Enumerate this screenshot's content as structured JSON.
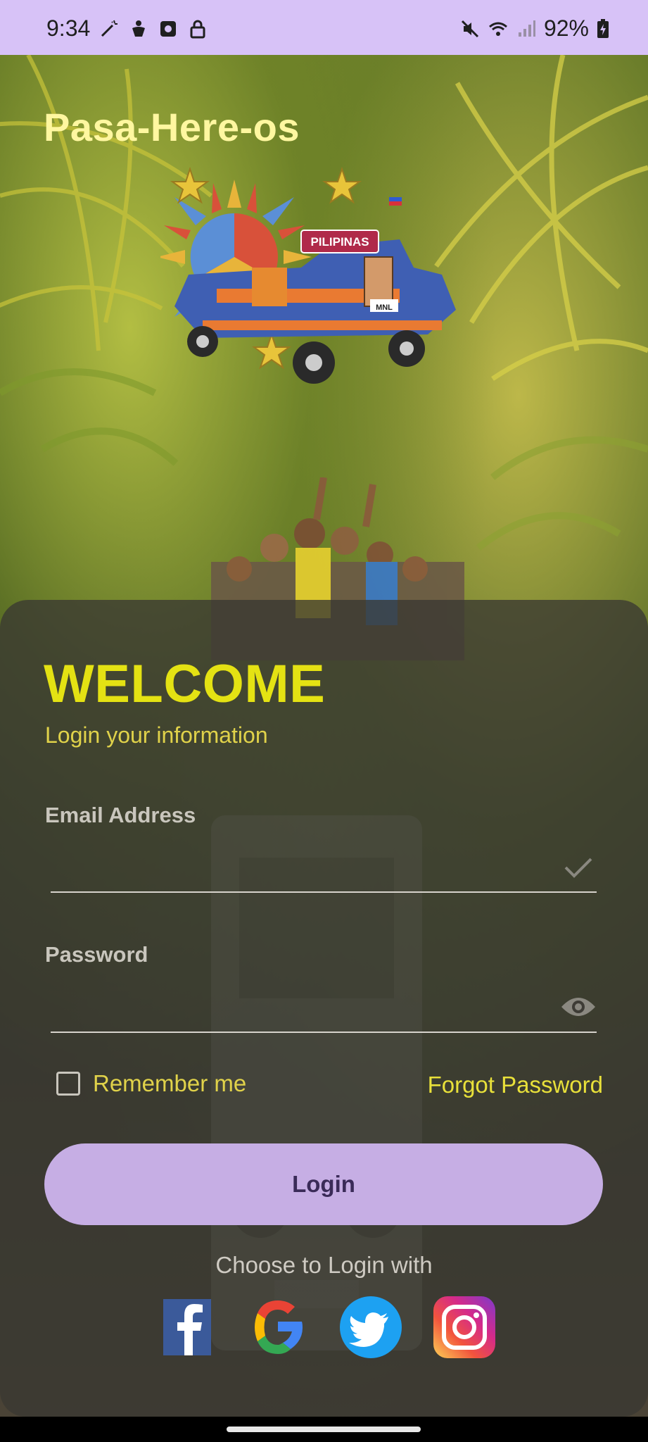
{
  "status_bar": {
    "time": "9:34",
    "battery": "92%",
    "left_icons": [
      "magic-wand-icon",
      "accessibility-icon",
      "screen-record-icon",
      "lock-icon"
    ],
    "right_icons": [
      "mute-icon",
      "wifi-icon",
      "signal-icon",
      "battery-charging-icon"
    ]
  },
  "app": {
    "title": "Pasa-Here-os",
    "logo_text": "PILIPINAS",
    "plate_text": "MNL"
  },
  "login": {
    "heading": "WELCOME",
    "subtitle": "Login your information",
    "email_label": "Email Address",
    "email_value": "",
    "password_label": "Password",
    "password_value": "",
    "remember_label": "Remember me",
    "remember_checked": false,
    "forgot_label": "Forgot Password",
    "login_button": "Login",
    "choose_label": "Choose to Login with"
  },
  "social": [
    "facebook-icon",
    "google-icon",
    "twitter-icon",
    "instagram-icon"
  ],
  "colors": {
    "accent_yellow": "#e4e213",
    "button_purple": "#c6aee4",
    "status_bar": "#d7c2f7"
  }
}
